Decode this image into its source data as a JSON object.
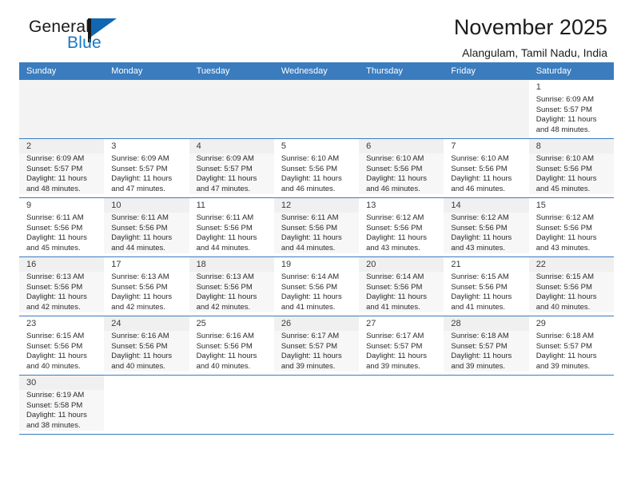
{
  "brand": {
    "name_part1": "General",
    "name_part2": "Blue",
    "flag_icon": "blue-flag-triangle",
    "accent_color": "#1878c4"
  },
  "header": {
    "title": "November 2025",
    "subtitle": "Alangulam, Tamil Nadu, India"
  },
  "theme": {
    "header_row_bg": "#3a7cbe",
    "row_divider": "#3a7cbe",
    "shaded_cell_bg": "#f3f3f3"
  },
  "calendar": {
    "weekday_headers": [
      "Sunday",
      "Monday",
      "Tuesday",
      "Wednesday",
      "Thursday",
      "Friday",
      "Saturday"
    ],
    "weeks": [
      [
        {
          "day": "",
          "sunrise": "",
          "sunset": "",
          "daylight_line1": "",
          "daylight_line2": "",
          "shaded": true,
          "empty": true
        },
        {
          "day": "",
          "sunrise": "",
          "sunset": "",
          "daylight_line1": "",
          "daylight_line2": "",
          "shaded": true,
          "empty": true
        },
        {
          "day": "",
          "sunrise": "",
          "sunset": "",
          "daylight_line1": "",
          "daylight_line2": "",
          "shaded": true,
          "empty": true
        },
        {
          "day": "",
          "sunrise": "",
          "sunset": "",
          "daylight_line1": "",
          "daylight_line2": "",
          "shaded": true,
          "empty": true
        },
        {
          "day": "",
          "sunrise": "",
          "sunset": "",
          "daylight_line1": "",
          "daylight_line2": "",
          "shaded": true,
          "empty": true
        },
        {
          "day": "",
          "sunrise": "",
          "sunset": "",
          "daylight_line1": "",
          "daylight_line2": "",
          "shaded": true,
          "empty": true
        },
        {
          "day": "1",
          "sunrise": "Sunrise: 6:09 AM",
          "sunset": "Sunset: 5:57 PM",
          "daylight_line1": "Daylight: 11 hours",
          "daylight_line2": "and 48 minutes.",
          "shaded": false,
          "empty": false
        }
      ],
      [
        {
          "day": "2",
          "sunrise": "Sunrise: 6:09 AM",
          "sunset": "Sunset: 5:57 PM",
          "daylight_line1": "Daylight: 11 hours",
          "daylight_line2": "and 48 minutes.",
          "shaded": true,
          "empty": false
        },
        {
          "day": "3",
          "sunrise": "Sunrise: 6:09 AM",
          "sunset": "Sunset: 5:57 PM",
          "daylight_line1": "Daylight: 11 hours",
          "daylight_line2": "and 47 minutes.",
          "shaded": false,
          "empty": false
        },
        {
          "day": "4",
          "sunrise": "Sunrise: 6:09 AM",
          "sunset": "Sunset: 5:57 PM",
          "daylight_line1": "Daylight: 11 hours",
          "daylight_line2": "and 47 minutes.",
          "shaded": true,
          "empty": false
        },
        {
          "day": "5",
          "sunrise": "Sunrise: 6:10 AM",
          "sunset": "Sunset: 5:56 PM",
          "daylight_line1": "Daylight: 11 hours",
          "daylight_line2": "and 46 minutes.",
          "shaded": false,
          "empty": false
        },
        {
          "day": "6",
          "sunrise": "Sunrise: 6:10 AM",
          "sunset": "Sunset: 5:56 PM",
          "daylight_line1": "Daylight: 11 hours",
          "daylight_line2": "and 46 minutes.",
          "shaded": true,
          "empty": false
        },
        {
          "day": "7",
          "sunrise": "Sunrise: 6:10 AM",
          "sunset": "Sunset: 5:56 PM",
          "daylight_line1": "Daylight: 11 hours",
          "daylight_line2": "and 46 minutes.",
          "shaded": false,
          "empty": false
        },
        {
          "day": "8",
          "sunrise": "Sunrise: 6:10 AM",
          "sunset": "Sunset: 5:56 PM",
          "daylight_line1": "Daylight: 11 hours",
          "daylight_line2": "and 45 minutes.",
          "shaded": true,
          "empty": false
        }
      ],
      [
        {
          "day": "9",
          "sunrise": "Sunrise: 6:11 AM",
          "sunset": "Sunset: 5:56 PM",
          "daylight_line1": "Daylight: 11 hours",
          "daylight_line2": "and 45 minutes.",
          "shaded": false,
          "empty": false
        },
        {
          "day": "10",
          "sunrise": "Sunrise: 6:11 AM",
          "sunset": "Sunset: 5:56 PM",
          "daylight_line1": "Daylight: 11 hours",
          "daylight_line2": "and 44 minutes.",
          "shaded": true,
          "empty": false
        },
        {
          "day": "11",
          "sunrise": "Sunrise: 6:11 AM",
          "sunset": "Sunset: 5:56 PM",
          "daylight_line1": "Daylight: 11 hours",
          "daylight_line2": "and 44 minutes.",
          "shaded": false,
          "empty": false
        },
        {
          "day": "12",
          "sunrise": "Sunrise: 6:11 AM",
          "sunset": "Sunset: 5:56 PM",
          "daylight_line1": "Daylight: 11 hours",
          "daylight_line2": "and 44 minutes.",
          "shaded": true,
          "empty": false
        },
        {
          "day": "13",
          "sunrise": "Sunrise: 6:12 AM",
          "sunset": "Sunset: 5:56 PM",
          "daylight_line1": "Daylight: 11 hours",
          "daylight_line2": "and 43 minutes.",
          "shaded": false,
          "empty": false
        },
        {
          "day": "14",
          "sunrise": "Sunrise: 6:12 AM",
          "sunset": "Sunset: 5:56 PM",
          "daylight_line1": "Daylight: 11 hours",
          "daylight_line2": "and 43 minutes.",
          "shaded": true,
          "empty": false
        },
        {
          "day": "15",
          "sunrise": "Sunrise: 6:12 AM",
          "sunset": "Sunset: 5:56 PM",
          "daylight_line1": "Daylight: 11 hours",
          "daylight_line2": "and 43 minutes.",
          "shaded": false,
          "empty": false
        }
      ],
      [
        {
          "day": "16",
          "sunrise": "Sunrise: 6:13 AM",
          "sunset": "Sunset: 5:56 PM",
          "daylight_line1": "Daylight: 11 hours",
          "daylight_line2": "and 42 minutes.",
          "shaded": true,
          "empty": false
        },
        {
          "day": "17",
          "sunrise": "Sunrise: 6:13 AM",
          "sunset": "Sunset: 5:56 PM",
          "daylight_line1": "Daylight: 11 hours",
          "daylight_line2": "and 42 minutes.",
          "shaded": false,
          "empty": false
        },
        {
          "day": "18",
          "sunrise": "Sunrise: 6:13 AM",
          "sunset": "Sunset: 5:56 PM",
          "daylight_line1": "Daylight: 11 hours",
          "daylight_line2": "and 42 minutes.",
          "shaded": true,
          "empty": false
        },
        {
          "day": "19",
          "sunrise": "Sunrise: 6:14 AM",
          "sunset": "Sunset: 5:56 PM",
          "daylight_line1": "Daylight: 11 hours",
          "daylight_line2": "and 41 minutes.",
          "shaded": false,
          "empty": false
        },
        {
          "day": "20",
          "sunrise": "Sunrise: 6:14 AM",
          "sunset": "Sunset: 5:56 PM",
          "daylight_line1": "Daylight: 11 hours",
          "daylight_line2": "and 41 minutes.",
          "shaded": true,
          "empty": false
        },
        {
          "day": "21",
          "sunrise": "Sunrise: 6:15 AM",
          "sunset": "Sunset: 5:56 PM",
          "daylight_line1": "Daylight: 11 hours",
          "daylight_line2": "and 41 minutes.",
          "shaded": false,
          "empty": false
        },
        {
          "day": "22",
          "sunrise": "Sunrise: 6:15 AM",
          "sunset": "Sunset: 5:56 PM",
          "daylight_line1": "Daylight: 11 hours",
          "daylight_line2": "and 40 minutes.",
          "shaded": true,
          "empty": false
        }
      ],
      [
        {
          "day": "23",
          "sunrise": "Sunrise: 6:15 AM",
          "sunset": "Sunset: 5:56 PM",
          "daylight_line1": "Daylight: 11 hours",
          "daylight_line2": "and 40 minutes.",
          "shaded": false,
          "empty": false
        },
        {
          "day": "24",
          "sunrise": "Sunrise: 6:16 AM",
          "sunset": "Sunset: 5:56 PM",
          "daylight_line1": "Daylight: 11 hours",
          "daylight_line2": "and 40 minutes.",
          "shaded": true,
          "empty": false
        },
        {
          "day": "25",
          "sunrise": "Sunrise: 6:16 AM",
          "sunset": "Sunset: 5:56 PM",
          "daylight_line1": "Daylight: 11 hours",
          "daylight_line2": "and 40 minutes.",
          "shaded": false,
          "empty": false
        },
        {
          "day": "26",
          "sunrise": "Sunrise: 6:17 AM",
          "sunset": "Sunset: 5:57 PM",
          "daylight_line1": "Daylight: 11 hours",
          "daylight_line2": "and 39 minutes.",
          "shaded": true,
          "empty": false
        },
        {
          "day": "27",
          "sunrise": "Sunrise: 6:17 AM",
          "sunset": "Sunset: 5:57 PM",
          "daylight_line1": "Daylight: 11 hours",
          "daylight_line2": "and 39 minutes.",
          "shaded": false,
          "empty": false
        },
        {
          "day": "28",
          "sunrise": "Sunrise: 6:18 AM",
          "sunset": "Sunset: 5:57 PM",
          "daylight_line1": "Daylight: 11 hours",
          "daylight_line2": "and 39 minutes.",
          "shaded": true,
          "empty": false
        },
        {
          "day": "29",
          "sunrise": "Sunrise: 6:18 AM",
          "sunset": "Sunset: 5:57 PM",
          "daylight_line1": "Daylight: 11 hours",
          "daylight_line2": "and 39 minutes.",
          "shaded": false,
          "empty": false
        }
      ],
      [
        {
          "day": "30",
          "sunrise": "Sunrise: 6:19 AM",
          "sunset": "Sunset: 5:58 PM",
          "daylight_line1": "Daylight: 11 hours",
          "daylight_line2": "and 38 minutes.",
          "shaded": true,
          "empty": false
        },
        {
          "day": "",
          "sunrise": "",
          "sunset": "",
          "daylight_line1": "",
          "daylight_line2": "",
          "shaded": false,
          "empty": true
        },
        {
          "day": "",
          "sunrise": "",
          "sunset": "",
          "daylight_line1": "",
          "daylight_line2": "",
          "shaded": false,
          "empty": true
        },
        {
          "day": "",
          "sunrise": "",
          "sunset": "",
          "daylight_line1": "",
          "daylight_line2": "",
          "shaded": false,
          "empty": true
        },
        {
          "day": "",
          "sunrise": "",
          "sunset": "",
          "daylight_line1": "",
          "daylight_line2": "",
          "shaded": false,
          "empty": true
        },
        {
          "day": "",
          "sunrise": "",
          "sunset": "",
          "daylight_line1": "",
          "daylight_line2": "",
          "shaded": false,
          "empty": true
        },
        {
          "day": "",
          "sunrise": "",
          "sunset": "",
          "daylight_line1": "",
          "daylight_line2": "",
          "shaded": false,
          "empty": true
        }
      ]
    ]
  }
}
